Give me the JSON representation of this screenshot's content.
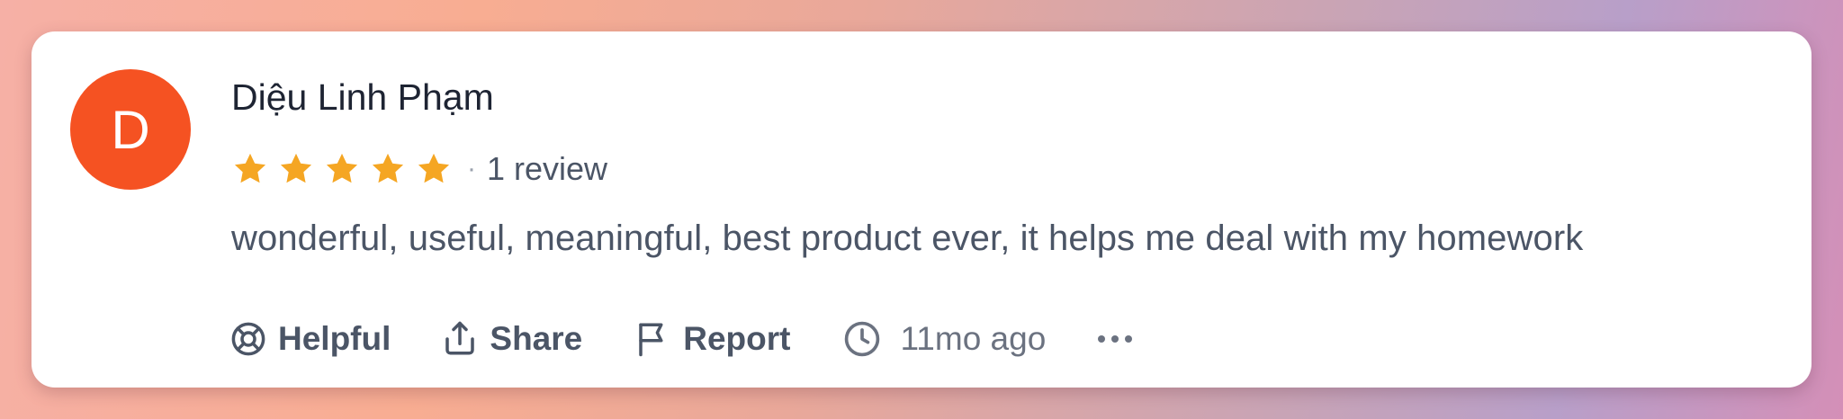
{
  "review": {
    "avatar_initial": "D",
    "author_name": "Diệu Linh Phạm",
    "rating": 5,
    "rating_max": 5,
    "separator": "·",
    "review_count": "1 review",
    "text": "wonderful, useful, meaningful, best product ever, it helps me deal with my homework",
    "timestamp": "11mo ago"
  },
  "actions": {
    "helpful_label": "Helpful",
    "share_label": "Share",
    "report_label": "Report"
  },
  "icons": {
    "helpful": "lifebuoy-icon",
    "share": "share-icon",
    "report": "flag-icon",
    "time": "clock-icon",
    "more": "ellipsis-icon",
    "star": "star-icon"
  },
  "colors": {
    "avatar": "#f55222",
    "star": "#f5a623",
    "text": "#4b5566",
    "name": "#1e2433"
  }
}
